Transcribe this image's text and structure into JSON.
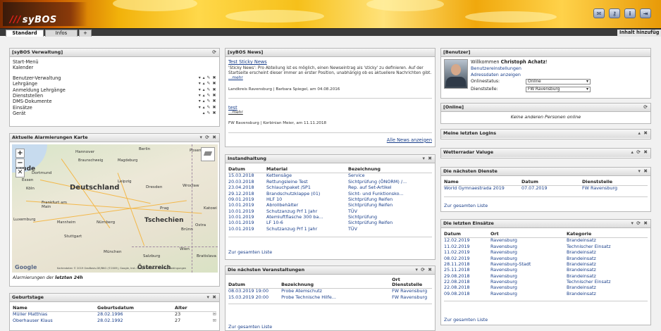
{
  "header": {
    "logo": "syBOS",
    "icons": [
      "mail-icon",
      "key-icon",
      "info-icon",
      "logout-icon"
    ]
  },
  "tabs": {
    "items": [
      "Standard",
      "Infos",
      "+"
    ],
    "add_content": "Inhalt hinzufüg"
  },
  "verwaltung": {
    "title": "[syBOS Verwaltung]",
    "top_items": [
      "Start-Menü",
      "Kalender"
    ],
    "items": [
      "Benutzer-Verwaltung",
      "Lehrgänge",
      "Anmeldung Lehrgänge",
      "Dienststellen",
      "DMS-Dokumente",
      "Einsätze",
      "Gerät"
    ]
  },
  "map": {
    "title": "Aktuelle Alarmierungen Karte",
    "caption_prefix": "Alarmierungen der ",
    "caption_bold": "letzten 24h",
    "google": "Google",
    "attribution": "Kartendaten © 2019 GeoBasis-DE/BKG (©2009), Google, Inst. Geogr. Nacional   Nutzungsbedingungen",
    "labels": {
      "de": "Deutschland",
      "cz": "Tschechien",
      "at": "Österreich",
      "nl": "lande",
      "hannover": "Hannover",
      "berlin": "Berlin",
      "posen": "Posen",
      "dortmund": "Dortmund",
      "essen": "Essen",
      "koeln": "Köln",
      "leipzig": "Leipzig",
      "dresden": "Dresden",
      "wroclaw": "Wrocław",
      "frankfurt": "Frankfurt am Main",
      "prag": "Prag",
      "katowice": "Katowi",
      "luxemburg": "Luxemburg",
      "nuernberg": "Nürnberg",
      "mannheim": "Mannheim",
      "stuttgart": "Stuttgart",
      "brno": "Brünn",
      "ostrava": "Ostra",
      "muenchen": "München",
      "wien": "Wien",
      "salzburg": "Salzburg",
      "bratislava": "Bratislava",
      "braunschweig": "Braunschweig",
      "magdeburg": "Magdeburg"
    }
  },
  "birthdays": {
    "title": "Geburtstage",
    "headers": [
      "Name",
      "Geburtsdatum",
      "Alter"
    ],
    "rows": [
      [
        "Müller Matthias",
        "28.02.1996",
        "23"
      ],
      [
        "Oberhauser Klaus",
        "28.02.1992",
        "27"
      ]
    ]
  },
  "news": {
    "title": "[syBOS News]",
    "items": [
      {
        "headline": "Test Sticky News",
        "body": "'Sticky News': Pro Abteilung ist es möglich, einen Newseintrag als 'sticky' zu definieren. Auf der Startseite erscheint dieser immer an erster Position, unabhängig ob es aktuellere Nachrichten gibt. ",
        "more": "...mehr",
        "sig": "Landkreis Ravensburg | Barbara Spiegel, am 04.08.2016"
      },
      {
        "headline": "test",
        "body": "",
        "more": "...mehr",
        "sig": "FW Ravensburg | Korbinian Meier, am 11.11.2018"
      }
    ],
    "all_news": "Alle News anzeigen"
  },
  "maintenance": {
    "title": "Instandhaltung",
    "headers": [
      "Datum",
      "Material",
      "Bezeichnung"
    ],
    "rows": [
      [
        "15.03.2018",
        "Kettensäge",
        "Service"
      ],
      [
        "20.03.2018",
        "Rettungsleine Test",
        "Sichtprüfung (ÖNORM) /..."
      ],
      [
        "23.04.2018",
        "Schlauchpaket /SP1",
        "Rep. auf Set-Artikel"
      ],
      [
        "29.12.2018",
        "Brandschutzklappe (01)",
        "Sicht- und Funktionsko..."
      ],
      [
        "09.01.2019",
        "HLF 10",
        "Sichtprüfung Reifen"
      ],
      [
        "10.01.2019",
        "Abrollbehälter",
        "Sichtprüfung Reifen"
      ],
      [
        "10.01.2019",
        "Schutzanzug Prf 1 Jahr",
        "TÜV"
      ],
      [
        "10.01.2019",
        "Atemluftflasche 300 ba...",
        "Sichtprüfung"
      ],
      [
        "10.01.2019",
        "LF 10-6",
        "Sichtprüfung Reifen"
      ],
      [
        "10.01.2019",
        "Schutzanzug Prf 1 Jahr",
        "TÜV"
      ]
    ],
    "footer": "Zur gesamten Liste"
  },
  "events": {
    "title": "Die nächsten Veranstaltungen",
    "headers": [
      "Datum",
      "Bezeichnung",
      "Ort Dienststelle"
    ],
    "rows": [
      [
        "08.03.2019 19:00",
        "Probe Atemschutz",
        "FW Ravensburg"
      ],
      [
        "15.03.2019 20:00",
        "Probe Technische Hilfe...",
        "FW Ravensburg"
      ]
    ],
    "footer": "Zur gesamten Liste"
  },
  "user": {
    "title": "[Benutzer]",
    "welcome_prefix": "Willkommen ",
    "name": "Christoph Achatz",
    "welcome_suffix": "!",
    "settings_link": "Benutzereinstellungen",
    "address_link": "Adressdaten anzeigen",
    "online_label": "Onlinestatus:",
    "online_value": "Online",
    "dept_label": "Dienststelle:",
    "dept_value": "FW Ravensburg"
  },
  "online": {
    "title": "[Online]",
    "text": "Keine anderen Personen online"
  },
  "logins": {
    "title": "Meine letzten Logins"
  },
  "weather": {
    "title": "Wetterradar Valuge"
  },
  "duties": {
    "title": "Die nächsten Dienste",
    "headers": [
      "Name",
      "Datum",
      "Dienststelle"
    ],
    "rows": [
      [
        "World Gymnaestrada 2019",
        "07.07.2019",
        "FW Ravensburg"
      ]
    ],
    "footer": "Zur gesamten Liste"
  },
  "missions": {
    "title": "Die letzten Einsätze",
    "headers": [
      "Datum",
      "Ort",
      "Kategorie"
    ],
    "rows": [
      [
        "12.02.2019",
        "Ravensburg",
        "Brandeinsatz"
      ],
      [
        "11.02.2019",
        "Ravensburg",
        "Technischer Einsatz"
      ],
      [
        "11.02.2019",
        "Ravensburg",
        "Brandeinsatz"
      ],
      [
        "08.02.2019",
        "Ravensburg",
        "Brandeinsatz"
      ],
      [
        "28.11.2018",
        "Ravensburg-Stadt",
        "Brandeinsatz"
      ],
      [
        "25.11.2018",
        "Ravensburg",
        "Brandeinsatz"
      ],
      [
        "29.08.2018",
        "Ravensburg",
        "Brandeinsatz"
      ],
      [
        "22.08.2018",
        "Ravensburg",
        "Technischer Einsatz"
      ],
      [
        "22.08.2018",
        "Ravensburg",
        "Brandeinsatz"
      ],
      [
        "09.08.2018",
        "Ravensburg",
        "Brandeinsatz"
      ]
    ],
    "footer": "Zur gesamten Liste"
  }
}
